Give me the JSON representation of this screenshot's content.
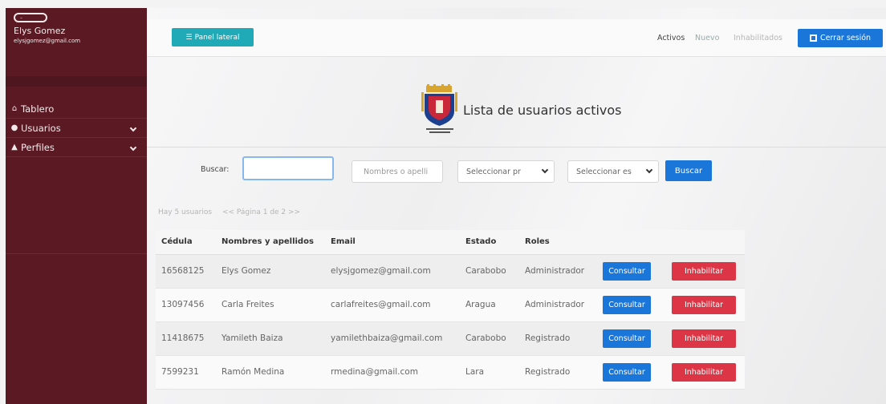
{
  "user": {
    "name": "Elys Gomez",
    "email": "elysjgomez@gmail.com"
  },
  "sidebar": {
    "items": [
      {
        "label": "Tablero",
        "icon": "home-icon"
      },
      {
        "label": "Usuarios",
        "icon": "user-icon"
      },
      {
        "label": "Perfiles",
        "icon": "users-icon"
      }
    ]
  },
  "topbar": {
    "panel_label": "Panel lateral",
    "nav": {
      "active": "Activos",
      "new": "Nuevo",
      "disabled": "Inhabilitados"
    },
    "logout_label": "Cerrar sesión"
  },
  "page": {
    "title": "Lista de usuarios activos"
  },
  "filters": {
    "search_label": "Buscar:",
    "search_value": "",
    "name_placeholder": "Nombres o apelli",
    "select1": "Seleccionar pr",
    "select2": "Seleccionar es",
    "search_button": "Buscar"
  },
  "summary": {
    "count": "Hay 5 usuarios",
    "pagination": "<< Página 1 de 2 >>"
  },
  "table": {
    "headers": [
      "Cédula",
      "Nombres y apellidos",
      "Email",
      "Estado",
      "Roles"
    ],
    "consult_label": "Consultar",
    "disable_label": "Inhabilitar",
    "rows": [
      {
        "cedula": "16568125",
        "name": "Elys Gomez",
        "email": "elysjgomez@gmail.com",
        "estado": "Carabobo",
        "rol": "Administrador"
      },
      {
        "cedula": "13097456",
        "name": "Carla Freites",
        "email": "carlafreites@gmail.com",
        "estado": "Aragua",
        "rol": "Administrador"
      },
      {
        "cedula": "11418675",
        "name": "Yamileth Baiza",
        "email": "yamilethbaiza@gmail.com",
        "estado": "Carabobo",
        "rol": "Registrado"
      },
      {
        "cedula": "7599231",
        "name": "Ramón Medina",
        "email": "rmedina@gmail.com",
        "estado": "Lara",
        "rol": "Registrado"
      }
    ]
  },
  "colors": {
    "sidebar": "#5b1a23",
    "primary": "#1a76d8",
    "danger": "#dc3545",
    "info": "#20aab7"
  }
}
